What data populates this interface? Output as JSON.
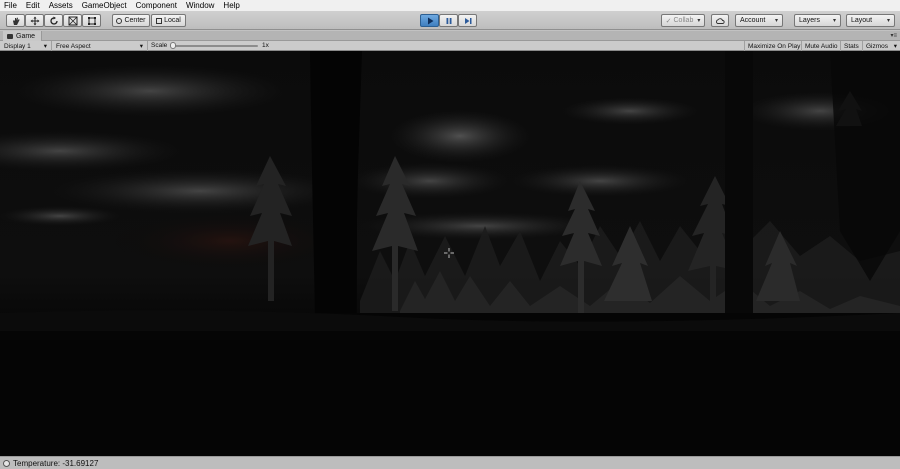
{
  "menu": [
    "File",
    "Edit",
    "Assets",
    "GameObject",
    "Component",
    "Window",
    "Help"
  ],
  "toolbar": {
    "tools": [
      "hand-icon",
      "move-icon",
      "rotate-icon",
      "scale-icon",
      "rect-icon"
    ],
    "pivot_label": "Center",
    "space_label": "Local",
    "collab_label": "Collab",
    "account_label": "Account",
    "layers_label": "Layers",
    "layout_label": "Layout",
    "play_state": "playing",
    "accent_color": "#3f7fbf"
  },
  "game_tab": {
    "title": "Game",
    "display_label": "Display 1",
    "aspect_label": "Free Aspect",
    "scale_label": "Scale",
    "scale_value": "1x",
    "scale_fraction": 0.0,
    "maximize_label": "Maximize On Play",
    "mute_label": "Mute Audio",
    "stats_label": "Stats",
    "gizmos_label": "Gizmos"
  },
  "status": {
    "text": "Temperature: -31.69127"
  }
}
